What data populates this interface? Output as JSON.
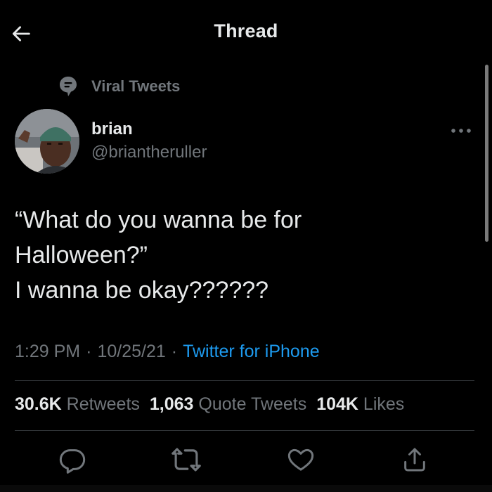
{
  "header": {
    "title": "Thread",
    "back_icon": "arrow-left-icon"
  },
  "context": {
    "label": "Viral Tweets",
    "icon": "topic-chat-icon"
  },
  "author": {
    "name": "brian",
    "handle": "@briantheruller",
    "more_icon": "more-horizontal-icon"
  },
  "tweet": {
    "lines": [
      "“What do you wanna be for",
      "Halloween?”",
      "I wanna be okay??????"
    ],
    "time": "1:29 PM",
    "date": "10/25/21",
    "source": "Twitter for iPhone"
  },
  "stats": {
    "retweets_count": "30.6K",
    "retweets_label": "Retweets",
    "quotes_count": "1,063",
    "quotes_label": "Quote Tweets",
    "likes_count": "104K",
    "likes_label": "Likes"
  },
  "actions": {
    "reply_icon": "reply-icon",
    "retweet_icon": "retweet-icon",
    "like_icon": "heart-icon",
    "share_icon": "share-icon"
  },
  "colors": {
    "background": "#000000",
    "text_primary": "#e7e9ea",
    "text_secondary": "#71767b",
    "link": "#1d9bf0",
    "divider": "#2f3336"
  }
}
